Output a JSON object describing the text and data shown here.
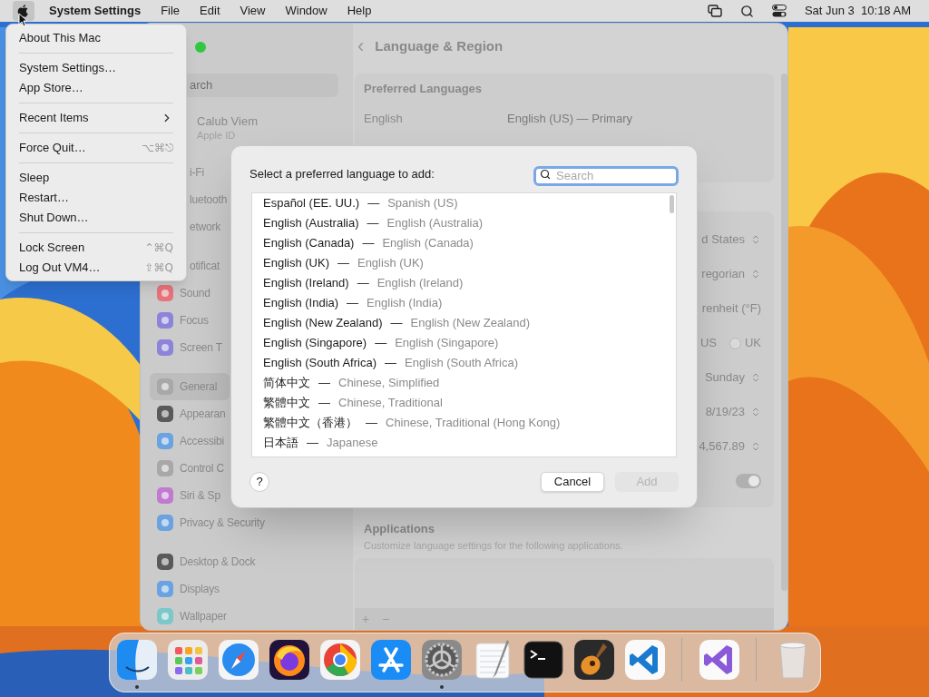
{
  "menu_bar": {
    "app_name": "System Settings",
    "menus": [
      "File",
      "Edit",
      "View",
      "Window",
      "Help"
    ],
    "clock": "Sat Jun 3  10:18 AM"
  },
  "apple_menu": {
    "groups": [
      [
        {
          "label": "About This Mac"
        }
      ],
      [
        {
          "label": "System Settings…"
        },
        {
          "label": "App Store…"
        }
      ],
      [
        {
          "label": "Recent Items",
          "submenu": true
        }
      ],
      [
        {
          "label": "Force Quit…",
          "shortcut": "⌥⌘⎋"
        }
      ],
      [
        {
          "label": "Sleep"
        },
        {
          "label": "Restart…"
        },
        {
          "label": "Shut Down…"
        }
      ],
      [
        {
          "label": "Lock Screen",
          "shortcut": "⌃⌘Q"
        },
        {
          "label": "Log Out VM4…",
          "shortcut": "⇧⌘Q"
        }
      ]
    ]
  },
  "settings_window": {
    "search_placeholder": "arch",
    "account": {
      "name": "Calub Viem",
      "subtitle": "Apple ID"
    },
    "sidebar_groups": [
      [
        {
          "label": "i-Fi",
          "kind": "covered",
          "selected": false
        },
        {
          "label": "luetooth",
          "kind": "covered",
          "selected": false
        },
        {
          "label": "etwork",
          "kind": "covered",
          "selected": false
        }
      ],
      [
        {
          "label": "otificat",
          "kind": "covered",
          "selected": false
        },
        {
          "label": "Sound",
          "kind": "sound",
          "selected": false
        },
        {
          "label": "Focus",
          "kind": "focus",
          "selected": false
        },
        {
          "label": "Screen T",
          "kind": "screen-time",
          "selected": false
        }
      ],
      [
        {
          "label": "General",
          "kind": "general",
          "selected": true
        },
        {
          "label": "Appearan",
          "kind": "appearance",
          "selected": false
        },
        {
          "label": "Accessibi",
          "kind": "accessibility",
          "selected": false
        },
        {
          "label": "Control C",
          "kind": "control",
          "selected": false
        },
        {
          "label": "Siri & Sp",
          "kind": "siri",
          "selected": false
        },
        {
          "label": "Privacy & Security",
          "kind": "privacy",
          "selected": false
        }
      ],
      [
        {
          "label": "Desktop & Dock",
          "kind": "desktop",
          "selected": false
        },
        {
          "label": "Displays",
          "kind": "displays",
          "selected": false
        },
        {
          "label": "Wallpaper",
          "kind": "wallpaper",
          "selected": false
        }
      ]
    ],
    "header": {
      "back": "‹",
      "title": "Language & Region"
    },
    "preferred_languages": {
      "title": "Preferred Languages",
      "rows": [
        {
          "name": "English",
          "detail": "English (US) — Primary"
        }
      ]
    },
    "region_rows": [
      {
        "kind": "popup",
        "value": "d States"
      },
      {
        "kind": "popup",
        "value": "regorian"
      },
      {
        "kind": "text",
        "value": "renheit (°F)"
      },
      {
        "kind": "radio",
        "value": "US",
        "option": {
          "label": "UK",
          "selected": false
        }
      },
      {
        "kind": "popup",
        "value": "Sunday"
      },
      {
        "kind": "popup",
        "value": "8/19/23"
      },
      {
        "kind": "popup",
        "value": "4,567.89"
      },
      {
        "kind": "toggle",
        "on": true
      }
    ],
    "applications": {
      "title": "Applications",
      "subtitle": "Customize language settings for the following applications.",
      "add": "+",
      "remove": "−"
    }
  },
  "language_dialog": {
    "prompt": "Select a preferred language to add:",
    "search": {
      "placeholder": "Search"
    },
    "separator": "—",
    "languages": [
      {
        "native": "Español (EE. UU.)",
        "english": "Spanish (US)",
        "selected": false
      },
      {
        "native": "English (Australia)",
        "english": "English (Australia)",
        "selected": false
      },
      {
        "native": "English (Canada)",
        "english": "English (Canada)",
        "selected": false
      },
      {
        "native": "English (UK)",
        "english": "English (UK)",
        "selected": false
      },
      {
        "native": "English (Ireland)",
        "english": "English (Ireland)",
        "selected": false
      },
      {
        "native": "English (India)",
        "english": "English (India)",
        "selected": false
      },
      {
        "native": "English (New Zealand)",
        "english": "English (New Zealand)",
        "selected": false
      },
      {
        "native": "English (Singapore)",
        "english": "English (Singapore)",
        "selected": false
      },
      {
        "native": "English (South Africa)",
        "english": "English (South Africa)",
        "selected": false
      },
      {
        "native": "简体中文",
        "english": "Chinese, Simplified",
        "selected": false
      },
      {
        "native": "繁體中文",
        "english": "Chinese, Traditional",
        "selected": false
      },
      {
        "native": "繁體中文（香港）",
        "english": "Chinese, Traditional (Hong Kong)",
        "selected": false
      },
      {
        "native": "日本語",
        "english": "Japanese",
        "selected": false
      }
    ],
    "help": "?",
    "buttons": [
      {
        "label": "Cancel",
        "disabled": false
      },
      {
        "label": "Add",
        "disabled": true
      }
    ]
  },
  "dock": {
    "items": [
      {
        "kind": "finder",
        "running": true
      },
      {
        "kind": "launchpad",
        "running": false
      },
      {
        "kind": "safari",
        "running": false
      },
      {
        "kind": "firefox",
        "running": false
      },
      {
        "kind": "chrome",
        "running": false
      },
      {
        "kind": "appstore",
        "running": false
      },
      {
        "kind": "settings",
        "running": true
      },
      {
        "kind": "textedit",
        "running": false
      },
      {
        "kind": "terminal",
        "running": false
      },
      {
        "kind": "garageband",
        "running": false
      },
      {
        "kind": "vscode",
        "running": false
      },
      {
        "kind": "separator"
      },
      {
        "kind": "vstudio",
        "running": false
      },
      {
        "kind": "separator"
      },
      {
        "kind": "trash",
        "running": false
      }
    ]
  }
}
